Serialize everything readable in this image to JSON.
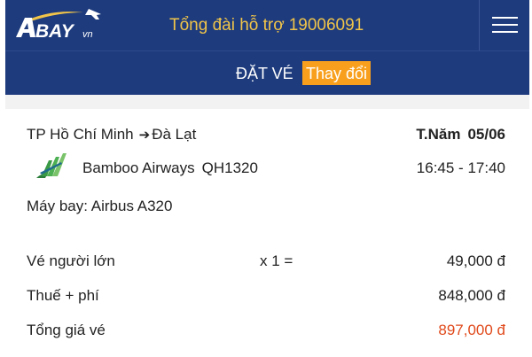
{
  "header": {
    "logo_text": "BAY",
    "logo_suffix": "vn",
    "hotline_label": "Tổng đài hỗ trợ",
    "hotline_number": "19006091",
    "menu_icon": "hamburger-menu-icon"
  },
  "booking": {
    "title": "ĐẶT VÉ",
    "change_label": "Thay đổi"
  },
  "flight": {
    "origin": "TP Hồ Chí Minh",
    "destination": "Đà Lạt",
    "day": "T.Năm",
    "date": "05/06",
    "airline": "Bamboo Airways",
    "flight_code": "QH1320",
    "time_range": "16:45 - 17:40",
    "aircraft": "Máy bay: Airbus A320"
  },
  "pricing": {
    "adult_label": "Vé người lớn",
    "adult_qty": "x 1 =",
    "adult_amount": "49,000 đ",
    "tax_label": "Thuế + phí",
    "tax_amount": "848,000 đ",
    "total_label": "Tổng giá vé",
    "total_amount": "897,000 đ"
  },
  "colors": {
    "header_bg": "#1e3b7d",
    "hotline_text": "#f0c449",
    "change_button": "#f8a01d",
    "total_price": "#e04a1c"
  }
}
